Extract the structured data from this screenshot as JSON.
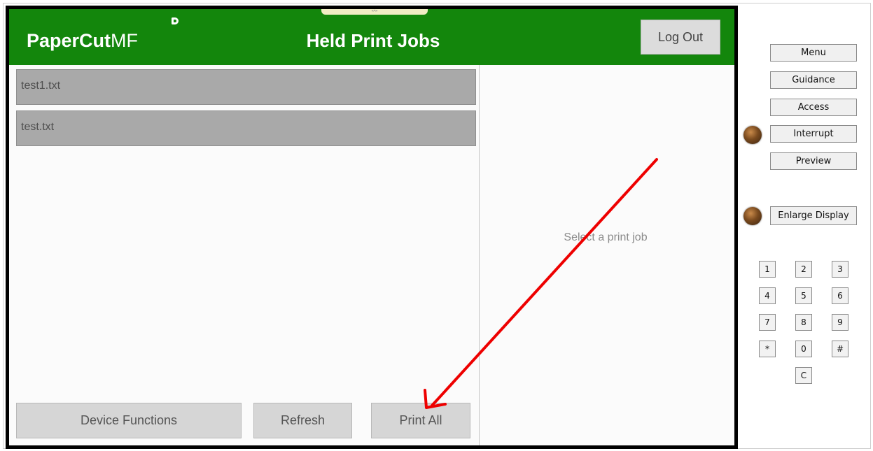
{
  "header": {
    "logo_text": "PaperCut",
    "logo_suffix": "MF",
    "title": "Held Print Jobs",
    "logout_label": "Log Out"
  },
  "jobs": [
    {
      "name": "test1.txt"
    },
    {
      "name": "test.txt"
    }
  ],
  "footer": {
    "device_functions_label": "Device Functions",
    "refresh_label": "Refresh",
    "print_all_label": "Print All"
  },
  "detail": {
    "placeholder": "Select a print job"
  },
  "side_panel": {
    "menu": "Menu",
    "guidance": "Guidance",
    "access": "Access",
    "interrupt": "Interrupt",
    "preview": "Preview",
    "enlarge_display": "Enlarge Display",
    "keys": [
      "1",
      "2",
      "3",
      "4",
      "5",
      "6",
      "7",
      "8",
      "9",
      "*",
      "0",
      "#",
      "C"
    ]
  },
  "colors": {
    "header_green": "#13860c",
    "annotation_arrow": "#ee0000"
  }
}
